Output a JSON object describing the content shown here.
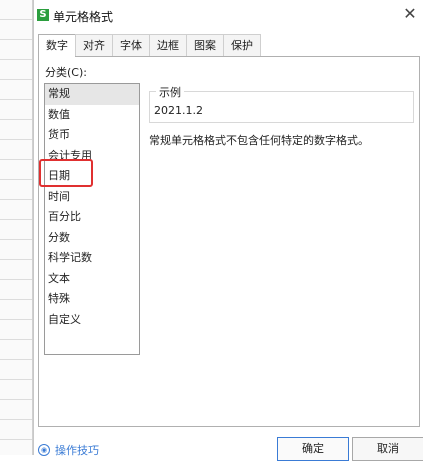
{
  "dialog": {
    "app_icon": "S",
    "title": "单元格格式",
    "close_glyph": "✕",
    "tabs": [
      {
        "label": "数字"
      },
      {
        "label": "对齐"
      },
      {
        "label": "字体"
      },
      {
        "label": "边框"
      },
      {
        "label": "图案"
      },
      {
        "label": "保护"
      }
    ],
    "category_label": "分类(C):",
    "categories": [
      "常规",
      "数值",
      "货币",
      "会计专用",
      "日期",
      "时间",
      "百分比",
      "分数",
      "科学记数",
      "文本",
      "特殊",
      "自定义"
    ],
    "sample": {
      "title": "示例",
      "value": "2021.1.2"
    },
    "description": "常规单元格格式不包含任何特定的数字格式。",
    "footer": {
      "tips_icon": "◉",
      "tips_label": "操作技巧",
      "ok_label": "确定",
      "cancel_label": "取消"
    }
  },
  "colors": {
    "highlight": "#e03030",
    "link": "#3a7bd5",
    "app_icon": "#2b9e3e"
  }
}
